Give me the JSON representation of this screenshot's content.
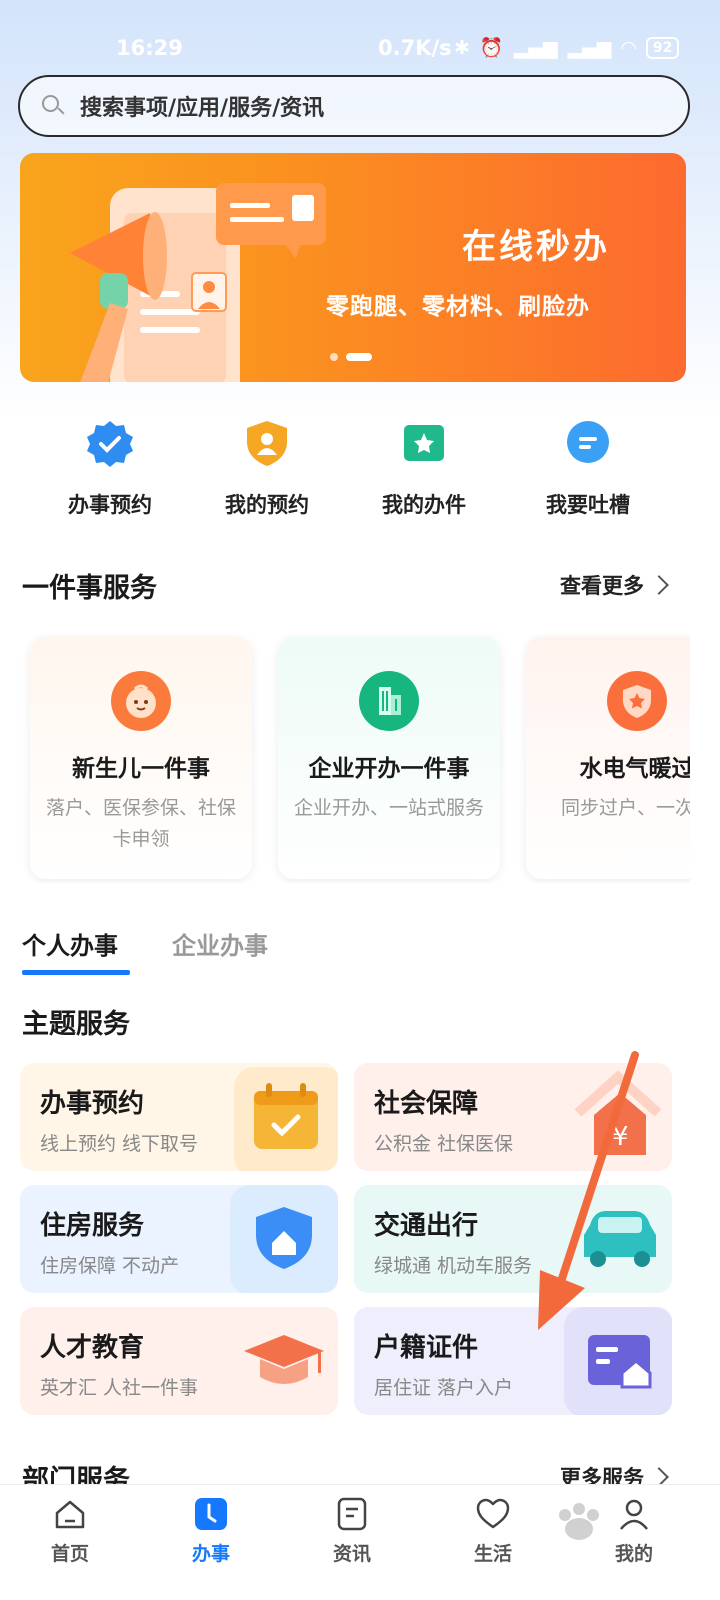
{
  "status": {
    "time": "16:29",
    "net_speed": "0.7K/s",
    "battery": "92"
  },
  "search": {
    "placeholder": "搜索事项/应用/服务/资讯"
  },
  "banner": {
    "title": "在线秒办",
    "subtitle": "零跑腿、零材料、刷脸办",
    "page_index": 1,
    "page_count": 2
  },
  "quick": [
    {
      "label": "办事预约",
      "icon": "verified-badge-icon",
      "color": "#2f8cf0"
    },
    {
      "label": "我的预约",
      "icon": "user-shield-icon",
      "color": "#f5a623"
    },
    {
      "label": "我的办件",
      "icon": "star-folder-icon",
      "color": "#1fb98c"
    },
    {
      "label": "我要吐槽",
      "icon": "chat-bubble-icon",
      "color": "#3aa0f5"
    }
  ],
  "one_thing": {
    "title": "一件事服务",
    "more": "查看更多",
    "cards": [
      {
        "title": "新生儿一件事",
        "desc": "落户、医保参保、社保卡申领",
        "icon": "baby-face-icon",
        "color": "#fb7b3c"
      },
      {
        "title": "企业开办一件事",
        "desc": "企业开办、一站式服务",
        "icon": "building-icon",
        "color": "#17b67e"
      },
      {
        "title": "水电气暖过",
        "desc": "同步过户、一次成",
        "icon": "shield-star-icon",
        "color": "#fb6f3c"
      }
    ]
  },
  "tabs": {
    "personal": "个人办事",
    "enterprise": "企业办事"
  },
  "theme": {
    "title": "主题服务",
    "items": [
      {
        "title": "办事预约",
        "desc": "线上预约 线下取号",
        "icon": "calendar-check-icon",
        "bg": "#fff6e8",
        "accent": "#f5b638"
      },
      {
        "title": "社会保障",
        "desc": "公积金 社保医保",
        "icon": "house-yen-icon",
        "bg": "#fff0ec",
        "accent": "#f2714a"
      },
      {
        "title": "住房服务",
        "desc": "住房保障 不动产",
        "icon": "house-shield-icon",
        "bg": "#eaf3ff",
        "accent": "#3a8ef6"
      },
      {
        "title": "交通出行",
        "desc": "绿城通 机动车服务",
        "icon": "car-icon",
        "bg": "#e8f8f7",
        "accent": "#2ec0c0"
      },
      {
        "title": "人才教育",
        "desc": "英才汇 人社一件事",
        "icon": "graduation-cap-icon",
        "bg": "#fff0ec",
        "accent": "#f2714a"
      },
      {
        "title": "户籍证件",
        "desc": "居住证 落户入户",
        "icon": "id-card-house-icon",
        "bg": "#eeeefc",
        "accent": "#6a62d8"
      }
    ]
  },
  "dept": {
    "title": "部门服务",
    "more": "更多服务"
  },
  "tabbar": [
    {
      "label": "首页",
      "icon": "home-icon",
      "active": false
    },
    {
      "label": "办事",
      "icon": "clock-tile-icon",
      "active": true
    },
    {
      "label": "资讯",
      "icon": "document-icon",
      "active": false
    },
    {
      "label": "生活",
      "icon": "heart-icon",
      "active": false
    },
    {
      "label": "我的",
      "icon": "person-icon",
      "active": false
    }
  ],
  "colors": {
    "brand": "#1677ff",
    "banner_start": "#f9a51c",
    "banner_end": "#fd6a2f",
    "arrow": "#f2693c"
  }
}
